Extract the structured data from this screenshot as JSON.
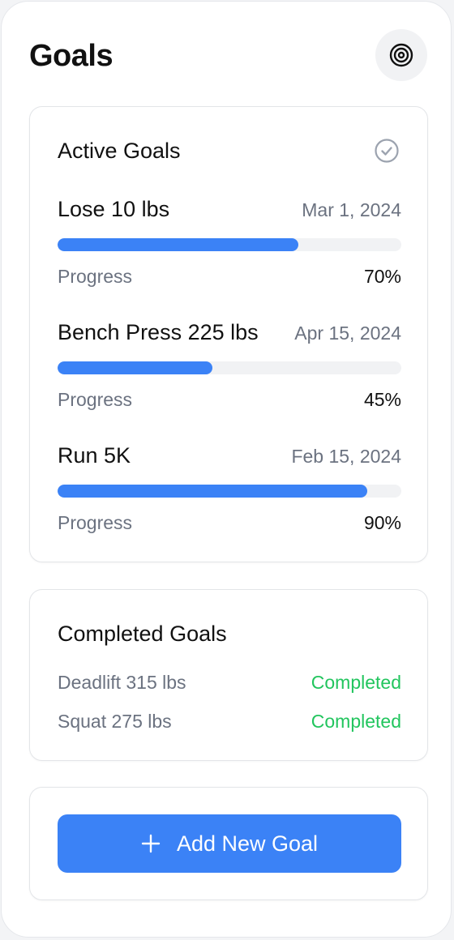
{
  "header": {
    "title": "Goals",
    "icon": "target-icon"
  },
  "active": {
    "title": "Active Goals",
    "icon": "check-circle-icon",
    "goals": [
      {
        "name": "Lose 10 lbs",
        "date": "Mar 1, 2024",
        "progress_label": "Progress",
        "progress_text": "70%",
        "progress": 70
      },
      {
        "name": "Bench Press 225 lbs",
        "date": "Apr 15, 2024",
        "progress_label": "Progress",
        "progress_text": "45%",
        "progress": 45
      },
      {
        "name": "Run 5K",
        "date": "Feb 15, 2024",
        "progress_label": "Progress",
        "progress_text": "90%",
        "progress": 90
      }
    ]
  },
  "completed": {
    "title": "Completed Goals",
    "items": [
      {
        "name": "Deadlift 315 lbs",
        "status": "Completed"
      },
      {
        "name": "Squat 275 lbs",
        "status": "Completed"
      }
    ]
  },
  "actions": {
    "add_label": "Add New Goal",
    "add_icon": "plus-icon"
  },
  "colors": {
    "accent": "#3b82f6",
    "success": "#22c55e",
    "muted_text": "#6b7280",
    "track": "#f1f2f4"
  }
}
